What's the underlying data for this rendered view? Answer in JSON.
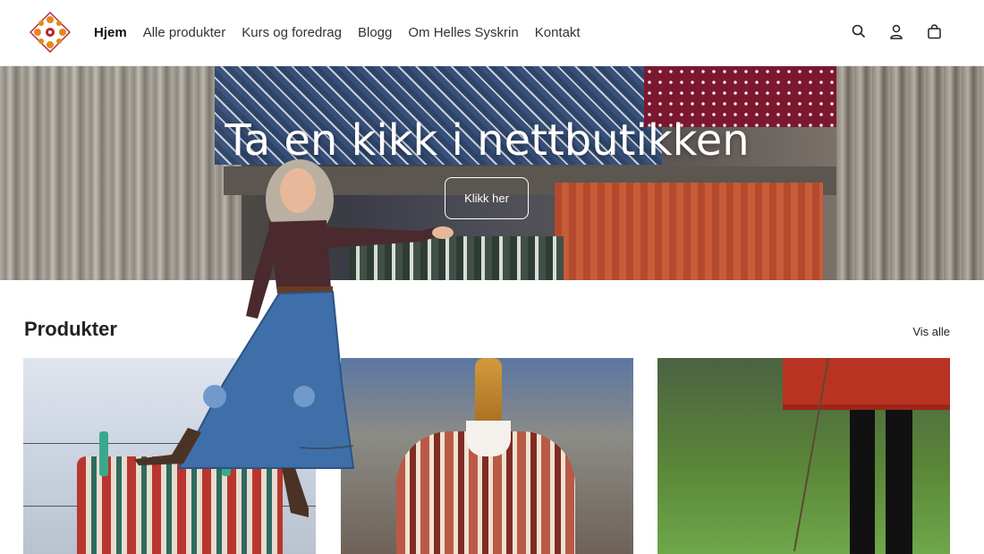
{
  "nav": {
    "items": [
      {
        "label": "Hjem",
        "active": true
      },
      {
        "label": "Alle produkter"
      },
      {
        "label": "Kurs og foredrag"
      },
      {
        "label": "Blogg"
      },
      {
        "label": "Om Helles Syskrin"
      },
      {
        "label": "Kontakt"
      }
    ],
    "icons": [
      "search-icon",
      "account-icon",
      "cart-icon"
    ]
  },
  "hero": {
    "title": "Ta en kikk i nettbutikken",
    "button_label": "Klikk her"
  },
  "products": {
    "title": "Produkter",
    "view_all": "Vis alle"
  },
  "colors": {
    "logo_orange": "#e8861c",
    "logo_red": "#b0242c",
    "text": "#1f1f1f"
  }
}
